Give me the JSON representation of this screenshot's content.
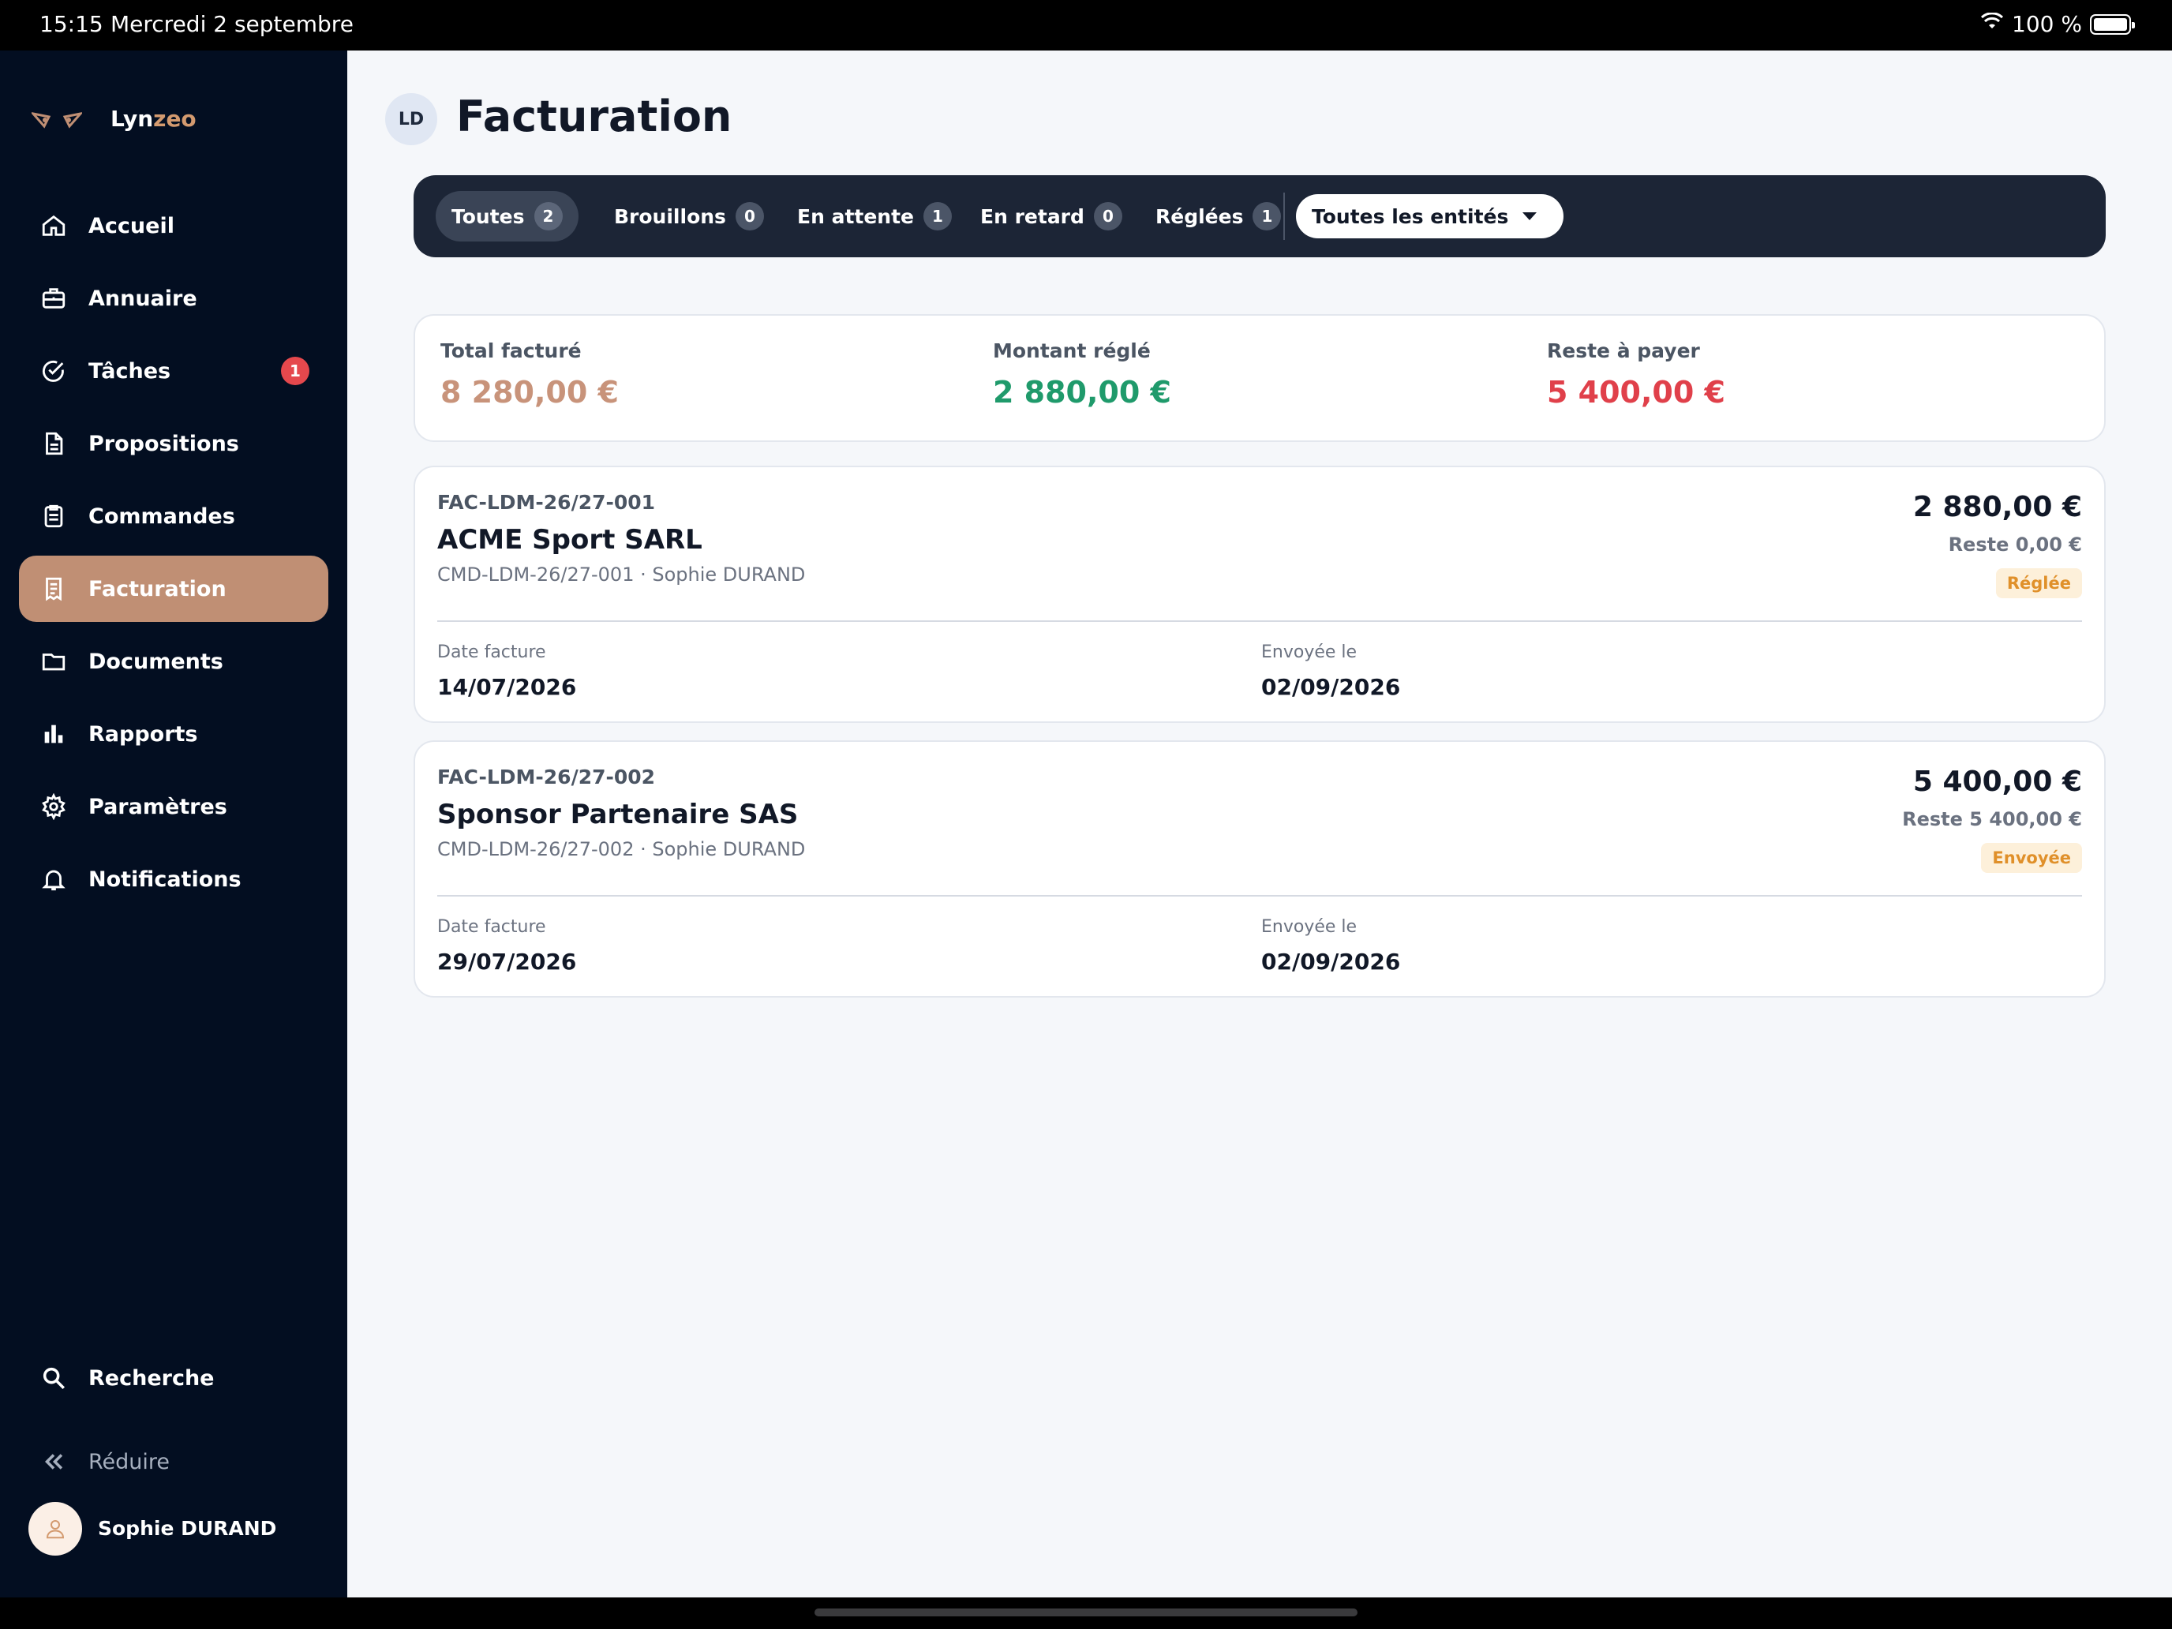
{
  "status_bar": {
    "time": "15:15",
    "date": "Mercredi 2 septembre",
    "battery": "100 %"
  },
  "sidebar": {
    "brand": {
      "prefix": "Lyn",
      "accent": "zeo"
    },
    "items": [
      {
        "label": "Accueil",
        "icon": "home-icon"
      },
      {
        "label": "Annuaire",
        "icon": "briefcase-icon"
      },
      {
        "label": "Tâches",
        "icon": "check-circle-icon",
        "badge": "1"
      },
      {
        "label": "Propositions",
        "icon": "document-icon"
      },
      {
        "label": "Commandes",
        "icon": "clipboard-icon"
      },
      {
        "label": "Facturation",
        "icon": "receipt-icon",
        "active": true
      },
      {
        "label": "Documents",
        "icon": "folder-icon"
      },
      {
        "label": "Rapports",
        "icon": "bar-chart-icon"
      },
      {
        "label": "Paramètres",
        "icon": "gear-icon"
      },
      {
        "label": "Notifications",
        "icon": "bell-icon"
      }
    ],
    "search_label": "Recherche",
    "reduce_label": "Réduire",
    "user_name": "Sophie DURAND"
  },
  "header": {
    "avatar_initials": "LD",
    "title": "Facturation"
  },
  "filters": {
    "chips": [
      {
        "label": "Toutes",
        "count": "2",
        "active": true
      },
      {
        "label": "Brouillons",
        "count": "0"
      },
      {
        "label": "En attente",
        "count": "1"
      },
      {
        "label": "En retard",
        "count": "0"
      },
      {
        "label": "Réglées",
        "count": "1"
      }
    ],
    "entity_select": "Toutes les entités"
  },
  "summary": {
    "total_label": "Total facturé",
    "total_value": "8 280,00 €",
    "paid_label": "Montant réglé",
    "paid_value": "2 880,00 €",
    "remaining_label": "Reste à payer",
    "remaining_value": "5 400,00 €"
  },
  "invoices": [
    {
      "number": "FAC-LDM-26/27-001",
      "client": "ACME Sport SARL",
      "subtitle": "CMD-LDM-26/27-001 · Sophie DURAND",
      "amount": "2 880,00 €",
      "rest": "Reste 0,00 €",
      "status": "Réglée",
      "date_label": "Date facture",
      "date_value": "14/07/2026",
      "sent_label": "Envoyée le",
      "sent_value": "02/09/2026"
    },
    {
      "number": "FAC-LDM-26/27-002",
      "client": "Sponsor Partenaire SAS",
      "subtitle": "CMD-LDM-26/27-002 · Sophie DURAND",
      "amount": "5 400,00 €",
      "rest": "Reste 5 400,00 €",
      "status": "Envoyée",
      "date_label": "Date facture",
      "date_value": "29/07/2026",
      "sent_label": "Envoyée le",
      "sent_value": "02/09/2026"
    }
  ],
  "colors": {
    "sidebar_bg": "#030e21",
    "active_item": "#c08f74",
    "total": "#c8937a",
    "paid": "#1f9a6b",
    "remaining": "#e0404a",
    "status_text": "#e0902a"
  }
}
